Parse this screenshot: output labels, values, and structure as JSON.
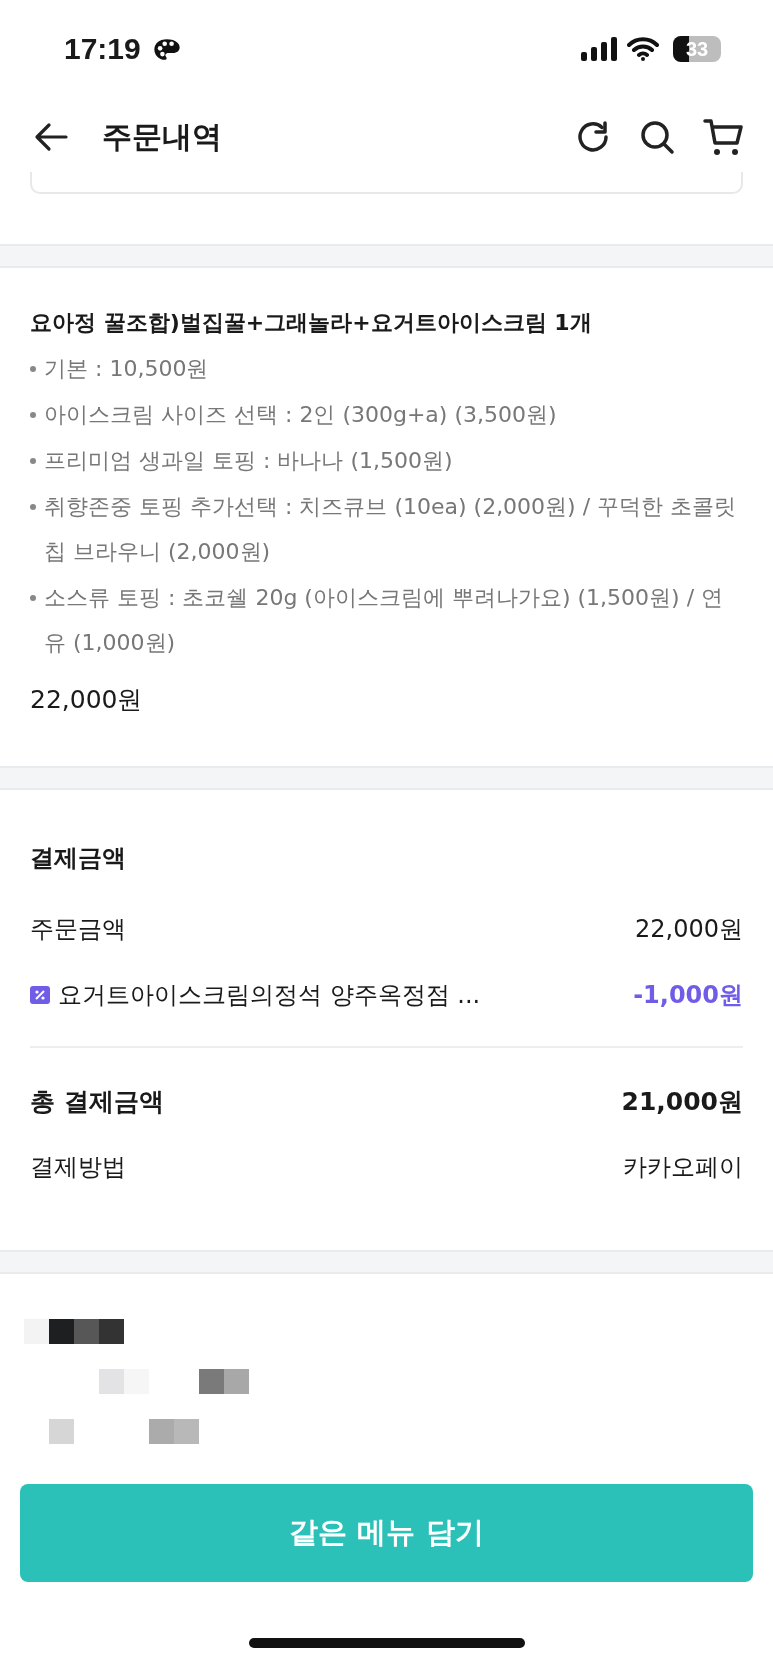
{
  "status_bar": {
    "time": "17:19",
    "battery": "33"
  },
  "header": {
    "title": "주문내역"
  },
  "order_item": {
    "title": "요아정 꿀조합)벌집꿀+그래놀라+요거트아이스크림 1개",
    "options": [
      "기본 : 10,500원",
      "아이스크림 사이즈 선택 : 2인 (300g+a) (3,500원)",
      "프리미엄 생과일 토핑 : 바나나 (1,500원)",
      "취향존중 토핑 추가선택 : 치즈큐브 (10ea) (2,000원) / 꾸덕한 초콜릿칩 브라우니 (2,000원)",
      "소스류 토핑 : 초코쉘 20g (아이스크림에 뿌려나가요) (1,500원) / 연유 (1,000원)"
    ],
    "price": "22,000원"
  },
  "payment": {
    "title": "결제금액",
    "rows": [
      {
        "kind": "plain",
        "label": "주문금액",
        "value": "22,000원"
      },
      {
        "kind": "coupon",
        "label": "요거트아이스크림의정석 양주옥정점 ...",
        "value": "-1,000원"
      }
    ],
    "total": {
      "label": "총 결제금액",
      "value": "21,000원"
    },
    "method": {
      "label": "결제방법",
      "value": "카카오페이"
    }
  },
  "button": "같은 메뉴 담기"
}
